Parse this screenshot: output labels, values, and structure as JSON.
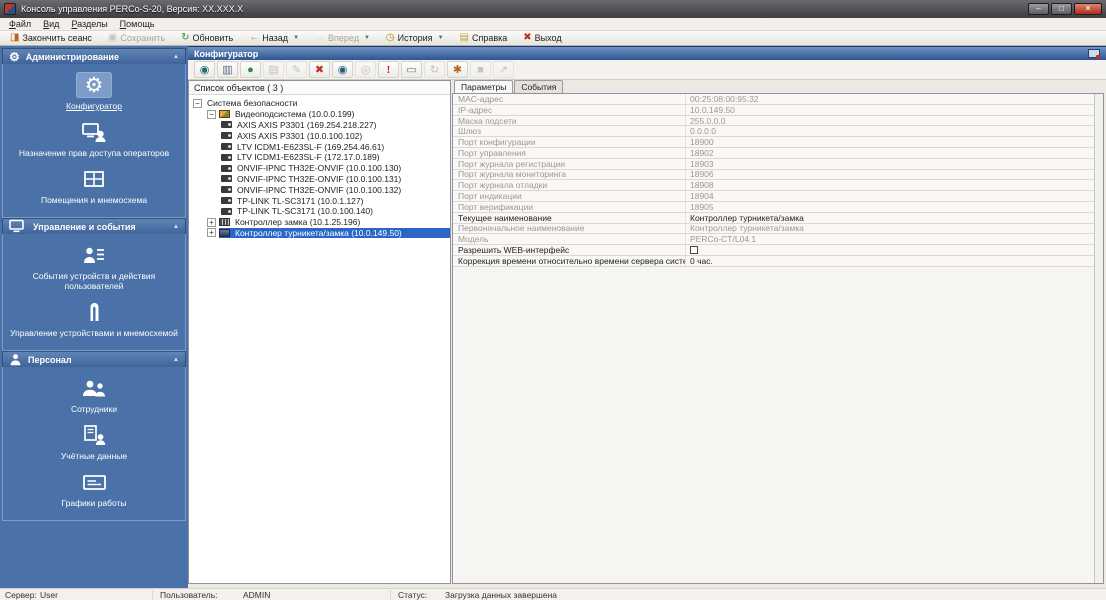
{
  "window": {
    "title": "Консоль управления PERCo-S-20, Версия: XX.XXX.X"
  },
  "menu": {
    "items": [
      {
        "name": "file",
        "label": "Файл"
      },
      {
        "name": "view",
        "label": "Вид"
      },
      {
        "name": "sections",
        "label": "Разделы"
      },
      {
        "name": "help",
        "label": "Помощь"
      }
    ]
  },
  "toolbar": {
    "buttons": [
      {
        "name": "end-session",
        "label": "Закончить сеанс",
        "icon": "end-session-icon",
        "enabled": true,
        "dropdown": false
      },
      {
        "name": "save",
        "label": "Сохранить",
        "icon": "save-icon",
        "enabled": false,
        "dropdown": false
      },
      {
        "name": "refresh",
        "label": "Обновить",
        "icon": "refresh-icon",
        "enabled": true,
        "dropdown": false
      },
      {
        "name": "back",
        "label": "Назад",
        "icon": "back-icon",
        "enabled": true,
        "dropdown": true
      },
      {
        "name": "forward",
        "label": "Вперед",
        "icon": "forward-icon",
        "enabled": false,
        "dropdown": true
      },
      {
        "name": "history",
        "label": "История",
        "icon": "history-icon",
        "enabled": true,
        "dropdown": true
      },
      {
        "name": "help",
        "label": "Справка",
        "icon": "help-icon",
        "enabled": true,
        "dropdown": false
      },
      {
        "name": "exit",
        "label": "Выход",
        "icon": "exit-icon",
        "enabled": true,
        "dropdown": false
      }
    ]
  },
  "sidebar": {
    "sections": [
      {
        "name": "administration",
        "title": "Администрирование",
        "icon": "gear-icon",
        "items": [
          {
            "name": "configurator",
            "label": "Конфигуратор",
            "icon": "configurator-gear-icon",
            "active": true
          },
          {
            "name": "operator-rights",
            "label": "Назначение прав доступа операторов",
            "icon": "operators-rights-icon",
            "active": false
          },
          {
            "name": "rooms-mnemoscheme",
            "label": "Помещения и мнемосхема",
            "icon": "rooms-mnemo-icon",
            "active": false
          }
        ]
      },
      {
        "name": "management-events",
        "title": "Управление и события",
        "icon": "monitor-icon",
        "items": [
          {
            "name": "device-events",
            "label": "События устройств и действия пользователей",
            "icon": "device-events-icon",
            "active": false
          },
          {
            "name": "device-management",
            "label": "Управление устройствами и мнемосхемой",
            "icon": "device-management-icon",
            "active": false
          }
        ]
      },
      {
        "name": "personnel",
        "title": "Персонал",
        "icon": "person-icon",
        "items": [
          {
            "name": "employees",
            "label": "Сотрудники",
            "icon": "employees-icon",
            "active": false
          },
          {
            "name": "credentials",
            "label": "Учётные данные",
            "icon": "credentials-icon",
            "active": false
          },
          {
            "name": "work-schedules",
            "label": "Графики работы",
            "icon": "schedules-icon",
            "active": false
          }
        ]
      }
    ]
  },
  "panel": {
    "title": "Конфигуратор",
    "toolbar": [
      {
        "name": "transfer-config",
        "icon": "transfer-config-icon",
        "enabled": true
      },
      {
        "name": "device-card",
        "icon": "device-card-icon",
        "enabled": true
      },
      {
        "name": "network-search",
        "icon": "network-icon",
        "enabled": true
      },
      {
        "name": "print",
        "icon": "print-icon",
        "enabled": false
      },
      {
        "name": "edit",
        "icon": "edit-icon",
        "enabled": false
      },
      {
        "name": "delete",
        "icon": "delete-icon",
        "enabled": true
      },
      {
        "name": "search",
        "icon": "search-icon",
        "enabled": true
      },
      {
        "name": "info",
        "icon": "info-icon",
        "enabled": false
      },
      {
        "name": "alert",
        "icon": "alert-icon",
        "enabled": true
      },
      {
        "name": "display",
        "icon": "display-icon",
        "enabled": true
      },
      {
        "name": "sync",
        "icon": "sync-icon",
        "enabled": false
      },
      {
        "name": "tools",
        "icon": "tools-icon",
        "enabled": true
      },
      {
        "name": "stop",
        "icon": "stop-icon",
        "enabled": false
      },
      {
        "name": "expand",
        "icon": "expand-icon",
        "enabled": false
      }
    ]
  },
  "objects": {
    "header": "Список объектов ( 3 )",
    "tree": [
      {
        "label": "Система безопасности",
        "level": 0,
        "expander": "minus",
        "icon": null,
        "selected": false
      },
      {
        "label": "Видеоподсистема (10.0.0.199)",
        "level": 1,
        "expander": "minus",
        "icon": "video-subsystem-icon",
        "selected": false
      },
      {
        "label": "AXIS AXIS P3301 (169.254.218.227)",
        "level": 2,
        "expander": null,
        "icon": "camera-icon",
        "selected": false
      },
      {
        "label": "AXIS AXIS P3301 (10.0.100.102)",
        "level": 2,
        "expander": null,
        "icon": "camera-icon",
        "selected": false
      },
      {
        "label": "LTV ICDM1-E623SL-F (169.254.46.61)",
        "level": 2,
        "expander": null,
        "icon": "camera-icon",
        "selected": false
      },
      {
        "label": "LTV ICDM1-E623SL-F (172.17.0.189)",
        "level": 2,
        "expander": null,
        "icon": "camera-icon",
        "selected": false
      },
      {
        "label": "ONVIF-IPNC TH32E-ONVIF (10.0.100.130)",
        "level": 2,
        "expander": null,
        "icon": "camera-icon",
        "selected": false
      },
      {
        "label": "ONVIF-IPNC TH32E-ONVIF (10.0.100.131)",
        "level": 2,
        "expander": null,
        "icon": "camera-icon",
        "selected": false
      },
      {
        "label": "ONVIF-IPNC TH32E-ONVIF (10.0.100.132)",
        "level": 2,
        "expander": null,
        "icon": "camera-icon",
        "selected": false
      },
      {
        "label": "TP-LINK TL-SC3171 (10.0.1.127)",
        "level": 2,
        "expander": null,
        "icon": "camera-icon",
        "selected": false
      },
      {
        "label": "TP-LINK TL-SC3171 (10.0.100.140)",
        "level": 2,
        "expander": null,
        "icon": "camera-icon",
        "selected": false
      },
      {
        "label": "Контроллер замка (10.1.25.196)",
        "level": 1,
        "expander": "plus",
        "icon": "lock-controller-icon",
        "selected": false
      },
      {
        "label": "Контроллер турникета/замка (10.0.149.50)",
        "level": 1,
        "expander": "plus",
        "icon": "turnstile-controller-icon",
        "selected": true
      }
    ]
  },
  "tabs": [
    {
      "label": "Параметры",
      "active": true
    },
    {
      "label": "События",
      "active": false
    }
  ],
  "params": {
    "rows": [
      {
        "label": "MAC-адрес",
        "value": "00:25:08:00:95:32",
        "readonly": true
      },
      {
        "label": "IP-адрес",
        "value": "10.0.149.50",
        "readonly": true
      },
      {
        "label": "Маска подсети",
        "value": "255.0.0.0",
        "readonly": true
      },
      {
        "label": "Шлюз",
        "value": "0.0.0.0",
        "readonly": true
      },
      {
        "label": "Порт конфигурации",
        "value": "18900",
        "readonly": true
      },
      {
        "label": "Порт управления",
        "value": "18902",
        "readonly": true
      },
      {
        "label": "Порт журнала регистрации",
        "value": "18903",
        "readonly": true
      },
      {
        "label": "Порт журнала мониторинга",
        "value": "18906",
        "readonly": true
      },
      {
        "label": "Порт журнала отладки",
        "value": "18908",
        "readonly": true
      },
      {
        "label": "Порт индикации",
        "value": "18904",
        "readonly": true
      },
      {
        "label": "Порт верификации",
        "value": "18905",
        "readonly": true
      },
      {
        "label": "Текущее наименование",
        "value": "Контроллер турникета/замка",
        "readonly": false
      },
      {
        "label": "Первоначальное наименование",
        "value": "Контроллер турникета/замка",
        "readonly": true
      },
      {
        "label": "Модель",
        "value": "PERCo-CT/L04.1",
        "readonly": true
      },
      {
        "label": "Разрешить WEB-интерфейс",
        "value": "",
        "readonly": false,
        "control": "checkbox",
        "checked": false
      },
      {
        "label": "Коррекция времени относительно времени сервера системы",
        "value": "0 час.",
        "readonly": false
      }
    ]
  },
  "statusbar": {
    "server_label": "Сервер:",
    "server": "User",
    "user_label": "Пользователь:",
    "user": "ADMIN",
    "status_label": "Статус:",
    "status": "Загрузка данных завершена"
  },
  "colors": {
    "sidebar": "#4a72a8",
    "selection": "#2a66c8",
    "panel_header": "#2e5590",
    "accent_red": "#c03020"
  }
}
